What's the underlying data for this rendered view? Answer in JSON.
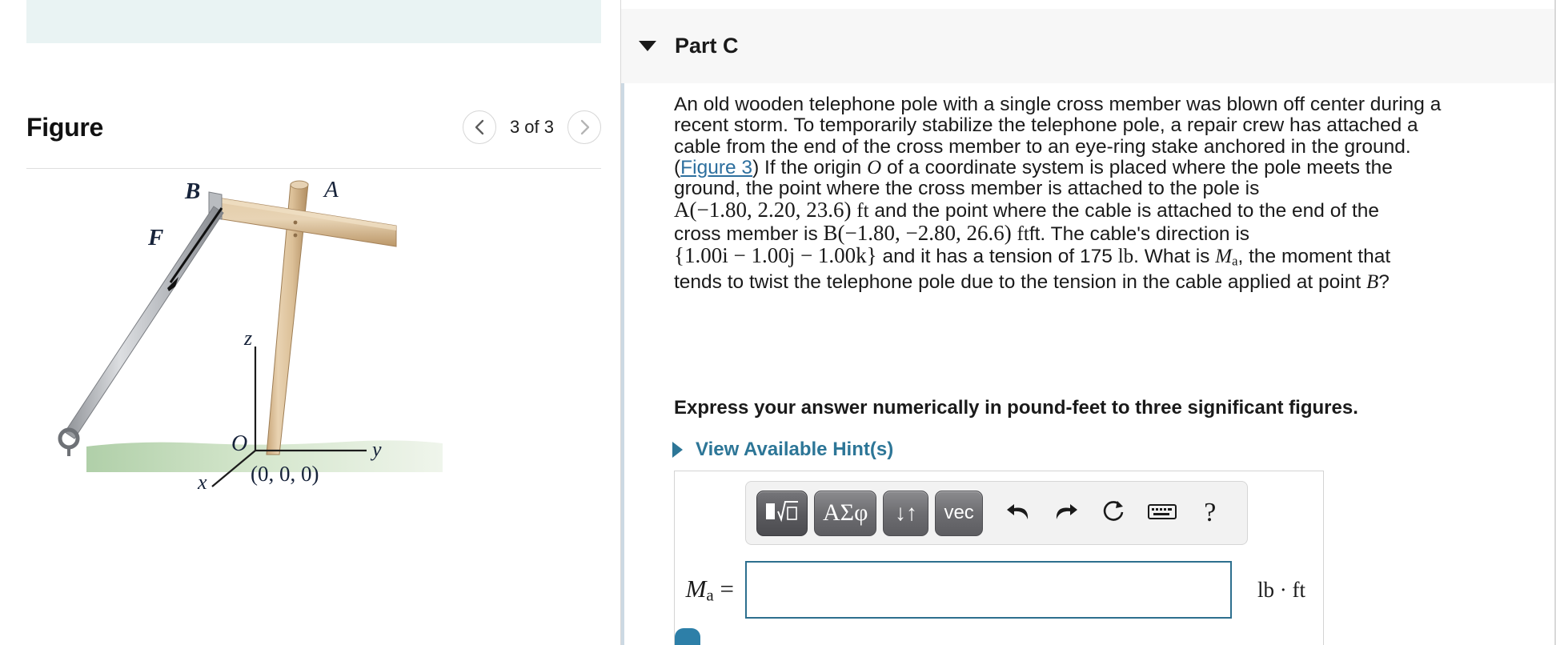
{
  "figure_panel": {
    "title": "Figure",
    "pager": {
      "prev_icon": "chevron-left-icon",
      "next_icon": "chevron-right-icon",
      "label": "3 of 3"
    },
    "diagram": {
      "labels": {
        "point_b": "B",
        "point_a": "A",
        "force": "F",
        "axis_z": "z",
        "axis_y": "y",
        "axis_x": "x",
        "origin": "O",
        "origin_coords": "(0, 0, 0)"
      },
      "colors": {
        "pole": "#dfc39c",
        "pole_dark": "#b9966a",
        "cable": "#b9bcc0",
        "grass": "#9fc49a",
        "ground_line": "#2b2b2b"
      }
    }
  },
  "part": {
    "caret_icon": "caret-down-icon",
    "title": "Part C"
  },
  "problem": {
    "lines": [
      "An old wooden telephone pole with a single cross member was blown off center during a",
      "recent storm. To temporarily stabilize the telephone pole, a repair crew has attached a",
      "cable from the end of the cross member to an eye-ring stake anchored in the ground."
    ],
    "figure_link": "Figure 3",
    "line4_after_link": ") If the origin",
    "origin_symbol": "O",
    "line4_tail": "of a coordinate system is placed where the pole meets the",
    "line5": "ground, the point where the cross member is attached to the pole is",
    "point_a": "A(−1.80, 2.20, 23.6)",
    "unit_ft": "ft",
    "line6_mid": "and the point where the cable is attached to the end of the",
    "line7_lead": "cross member is",
    "point_b": "B(−1.80, −2.80, 26.6)",
    "line7_tail": "ft. The cable's direction is",
    "direction_vector": "{1.00i − 1.00j − 1.00k}",
    "line8_mid": "and it has a tension of 175",
    "unit_lb": "lb",
    "line8_tail": ". What is",
    "moment_symbol": "M",
    "moment_subscript": "a",
    "line8_end": ", the moment that",
    "line9": "tends to twist the telephone pole due to the tension in the cable applied at point",
    "point_b_short": "B",
    "line9_end": "?"
  },
  "instruction": "Express your answer numerically in pound-feet to three significant figures.",
  "hints": {
    "caret_icon": "caret-right-icon",
    "label": "View Available Hint(s)"
  },
  "answer": {
    "toolbar": {
      "template_button": "template-math-icon",
      "greek_button": "ΑΣφ",
      "script_button": "↓↑",
      "vec_button": "vec",
      "undo_icon": "undo-icon",
      "redo_icon": "redo-icon",
      "reset_icon": "reset-icon",
      "keyboard_icon": "keyboard-icon",
      "help_icon": "?"
    },
    "label_symbol": "M",
    "label_subscript": "a",
    "label_equals": "=",
    "value": "",
    "placeholder": "",
    "units": "lb · ft"
  },
  "colors": {
    "accent_link": "#2d6f9e",
    "hint_link": "#2d7697",
    "input_border": "#2d6f8e",
    "part_header_bg": "#f7f7f7",
    "topbar_bg": "#e9f3f3"
  }
}
